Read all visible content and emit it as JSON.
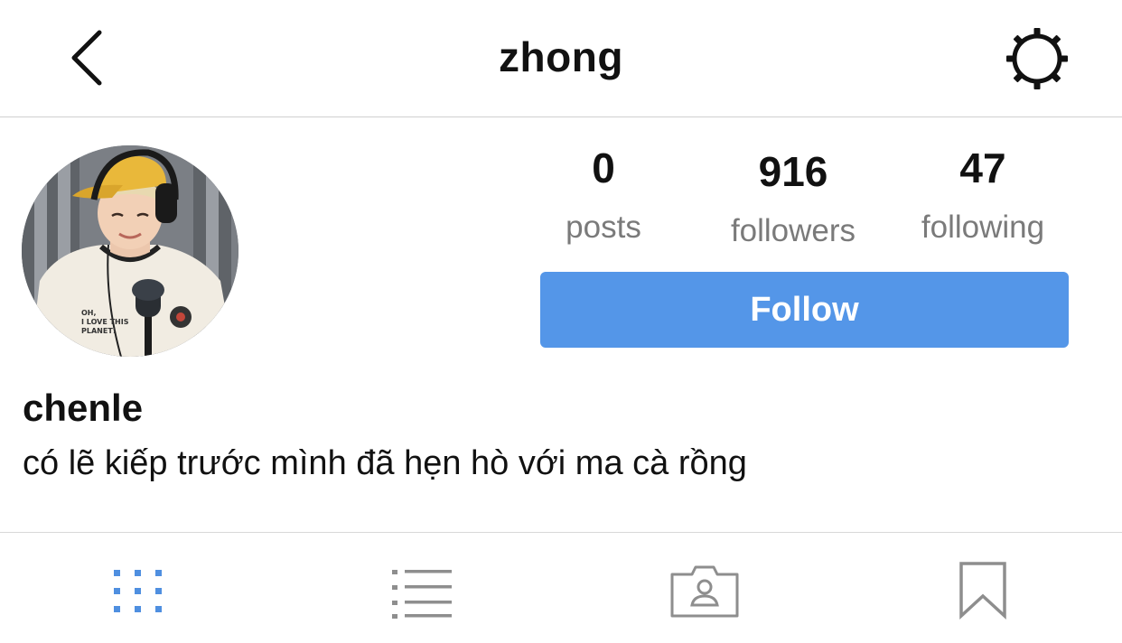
{
  "header": {
    "title": "zhong",
    "back_icon": "chevron-left-icon",
    "settings_icon": "gear-icon"
  },
  "profile": {
    "avatar": "profile-photo",
    "stats": {
      "posts": {
        "count": "0",
        "label": "posts"
      },
      "followers": {
        "count": "916",
        "label": "followers"
      },
      "following": {
        "count": "47",
        "label": "following"
      }
    },
    "follow_button": "Follow",
    "name": "chenle",
    "bio": "có lẽ kiếp trước mình đã hẹn hò với ma cà rồng",
    "shirt_text": "OH, I LOVE THIS PLANET!"
  },
  "tabs": [
    {
      "icon": "grid-icon",
      "active": true
    },
    {
      "icon": "list-icon",
      "active": false
    },
    {
      "icon": "tagged-icon",
      "active": false
    },
    {
      "icon": "bookmark-icon",
      "active": false
    }
  ],
  "colors": {
    "accent": "#5496e8",
    "active_tab": "#4f8fe0",
    "inactive_tab": "#8e8e8e",
    "label_gray": "#7a7a7a",
    "divider": "#cfcfcf"
  }
}
